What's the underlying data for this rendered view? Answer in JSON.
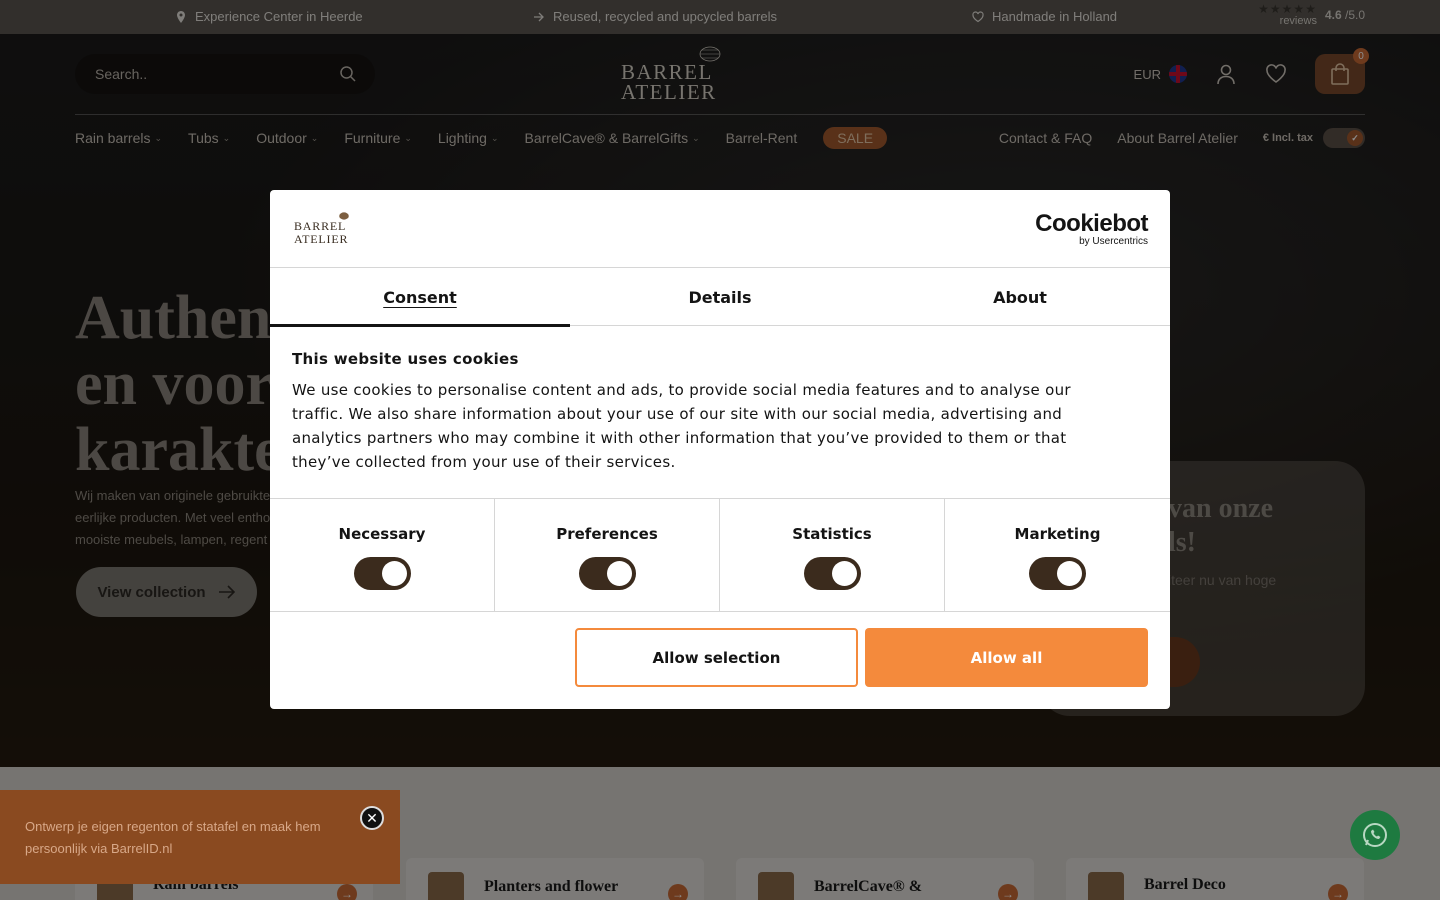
{
  "topbar": {
    "usp1": "Experience Center in Heerde",
    "usp2": "Reused, recycled and upcycled barrels",
    "usp3": "Handmade in Holland",
    "reviews_label": "reviews",
    "score": "4.6",
    "score_max": "/5.0",
    "stars": "★★★★★"
  },
  "header": {
    "search_placeholder": "Search..",
    "logo_text": "BARREL ATELIER",
    "currency": "EUR",
    "cart_count": "0"
  },
  "nav": {
    "items": [
      {
        "label": "Rain barrels",
        "has_dropdown": true
      },
      {
        "label": "Tubs",
        "has_dropdown": true
      },
      {
        "label": "Outdoor",
        "has_dropdown": true
      },
      {
        "label": "Furniture",
        "has_dropdown": true
      },
      {
        "label": "Lighting",
        "has_dropdown": true
      },
      {
        "label": "BarrelCave® & BarrelGifts",
        "has_dropdown": true
      },
      {
        "label": "Barrel-Rent",
        "has_dropdown": false
      }
    ],
    "sale": "SALE",
    "contact": "Contact & FAQ",
    "about": "About Barrel Atelier",
    "tax_label": "€ Incl. tax"
  },
  "hero": {
    "title": "Authent\nen voora\nkarakte",
    "sub1": "Wij maken van originele gebruikte",
    "sub2": "eerlijke producten. Met veel entho",
    "sub3": "mooiste meubels, lampen, regent",
    "button": "View collection",
    "promo_title": "van onze\nls!",
    "promo_text": "iteer nu van hoge"
  },
  "cookie": {
    "logo_text": "BARREL ATELIER",
    "brand": "Cookiebot",
    "brand_sub": "by Usercentrics",
    "tabs": [
      "Consent",
      "Details",
      "About"
    ],
    "heading": "This website uses cookies",
    "body": "We use cookies to personalise content and ads, to provide social media features and to analyse our traffic. We also share information about your use of our site with our social media, advertising and analytics partners who may combine it with other information that you’ve provided to them or that they’ve collected from your use of their services.",
    "categories": [
      "Necessary",
      "Preferences",
      "Statistics",
      "Marketing"
    ],
    "btn_selection": "Allow selection",
    "btn_all": "Allow all",
    "accent": "#f48a3c"
  },
  "toast": {
    "text": "Ontwerp je eigen regenton of statafel en maak hem persoonlijk via BarrelID.nl"
  },
  "categories": [
    {
      "label": "Rain barrels"
    },
    {
      "label": "Planters and flower"
    },
    {
      "label": "BarrelCave® &"
    },
    {
      "label": "Barrel Deco"
    }
  ]
}
